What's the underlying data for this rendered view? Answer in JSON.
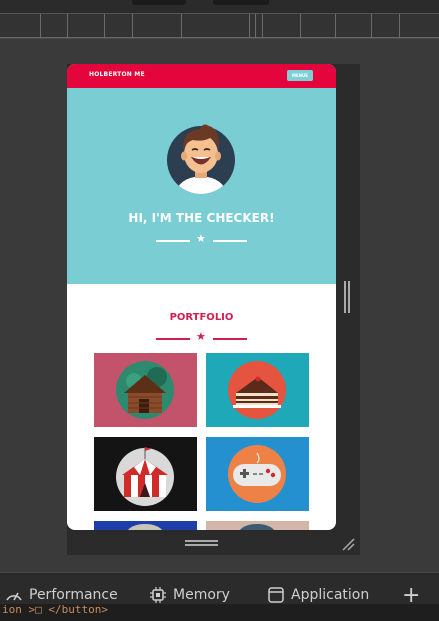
{
  "nav": {
    "brand": "HOLBERTON ME",
    "button_label": "MENUE"
  },
  "hero": {
    "title": "HI, I'M THE CHECKER!"
  },
  "portfolio": {
    "title": "PORTFOLIO",
    "tiles": [
      {
        "name": "cabin",
        "bg": "#c2536b",
        "circle": "#2e8a6e"
      },
      {
        "name": "cake",
        "bg": "#1fa9b8",
        "circle": "#e4543f"
      },
      {
        "name": "circus-tent",
        "bg": "#141414",
        "circle": "#d9d9d9"
      },
      {
        "name": "gamepad",
        "bg": "#2490cf",
        "circle": "#ee8246"
      },
      {
        "name": "partial-1",
        "bg": "#1f3fa8"
      },
      {
        "name": "partial-2",
        "bg": "#d2b7a8"
      }
    ]
  },
  "devtools": {
    "tabs": [
      {
        "label": "Performance",
        "icon": "performance-icon"
      },
      {
        "label": "Memory",
        "icon": "memory-icon"
      },
      {
        "label": "Application",
        "icon": "application-icon"
      }
    ],
    "add_label": "+",
    "console_text": "ion >□ </button>"
  },
  "colors": {
    "brand_red": "#e3053b",
    "hero_teal": "#79cdd3",
    "portfolio_pink": "#d11f51"
  }
}
